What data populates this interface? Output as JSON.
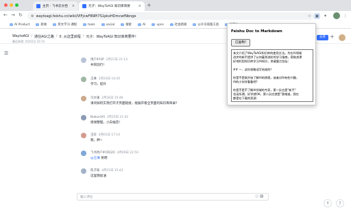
{
  "browser": {
    "tabs": [
      {
        "title": "主页 - 飞书云文档",
        "active": false,
        "icon_color": "#3370ff"
      },
      {
        "title": "元子：WayToAGI 知识库简要",
        "active": true,
        "icon_color": "#3370ff"
      }
    ],
    "url": "waytoagi.feishu.cn/wiki/VIFjcwFB9Pi7S1pkxHDmcwfNbnge",
    "bookmarks": [
      "AI Product",
      "新闻",
      "英文学习-课程",
      "tools",
      "social",
      "搜索",
      "AI",
      "vpns",
      "社会新闻",
      "公众号排版工具",
      "国内Sup"
    ]
  },
  "doc": {
    "breadcrumb": [
      "WaytoAGI",
      "通往AGI之路",
      "0. 从这里启程",
      "元子：WayToAGI 知识库简要伴！"
    ],
    "meta": "最近修改: 4月02日 22:14",
    "share_label": "分享",
    "menu_icon": "menu-icon"
  },
  "comments": [
    {
      "name": "用户9Y2P",
      "time": "2月21日 21:13",
      "text": "共同前行!",
      "mention": ""
    },
    {
      "name": "王琳",
      "time": "2月23日 14:20",
      "text": "学习，提升",
      "mention": ""
    },
    {
      "name": "马文谦",
      "time": "2月26日 15:48",
      "text": "请问如何实现打开子页面链接，能展开看全页面的知识库目录?",
      "mention": ""
    },
    {
      "name": "Bukun1AI",
      "time": "3月25日 21:42",
      "text": "感谢整理，小白福音!",
      "mention": ""
    },
    {
      "name": "王欢",
      "time": "4月01日 17:14",
      "text": "嗯，胖~",
      "mention": ""
    },
    {
      "name": "飞书用户9YZD2O",
      "time": "4月09日 22:50",
      "text": " 英明",
      "mention": "@王琳"
    },
    {
      "name": "陈子瑜",
      "time": "4月15日 15:43",
      "text": "这里我加油",
      "mention": ""
    }
  ],
  "comment_input": {
    "placeholder": "输入评论"
  },
  "popup": {
    "title": "Feishu Doc to Markdown",
    "copy_label": "已复制!",
    "lines": [
      "本文介绍了WayToAGI知识库的使用方法。为在AI领域",
      "进步的新手提供了从何着到进阶的学习指南，帮助其更",
      "好地利用知识库学习AI知识，关键要点包括：",
      "",
      "## 一、这份攻略适写给谁的？",
      "",
      "你是不是刚开始了解AI的原理，或者对AI有些兴趣，",
      "AI的小伙伴看看吧?",
      "",
      "你是不是不了解AI领域的专家，第一反应是\"新手\"",
      "也无所谓，好学就OK，第二反应就是\"我难道，我在",
      "都是在下载的资源："
    ]
  }
}
